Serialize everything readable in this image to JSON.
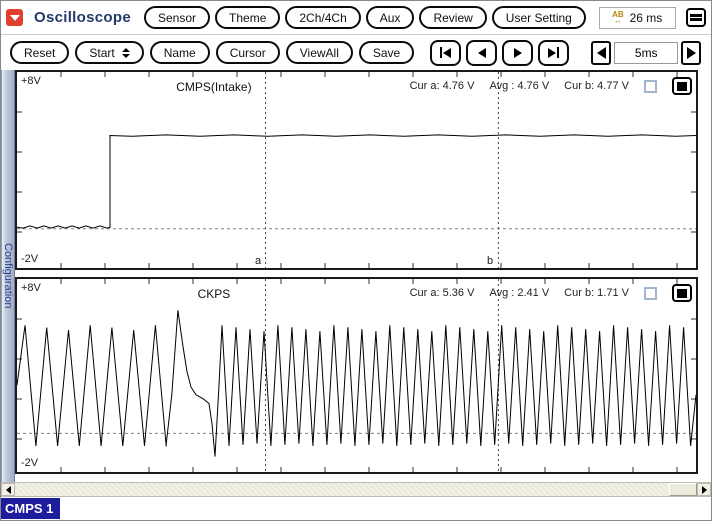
{
  "header": {
    "title": "Oscilloscope",
    "logo_icon": "red-dropdown-arrow",
    "menu_icon": "hamburger-menu",
    "ab_time_icon": "ab-cursor-time",
    "buttons": [
      "Sensor",
      "Theme",
      "2Ch/4Ch",
      "Aux",
      "Review",
      "User Setting"
    ],
    "time_display": "26 ms",
    "ab_icon_text": "AB",
    "ab_icon_arrows": "↔"
  },
  "toolbar": {
    "buttons": [
      "Reset",
      "Start",
      "Name",
      "Cursor",
      "ViewAll",
      "Save"
    ],
    "playback_icons": [
      "skip-to-start",
      "step-back",
      "step-forward",
      "skip-to-end"
    ],
    "timebase_value": "5ms",
    "timebase_icons": [
      "left-arrow",
      "right-arrow"
    ]
  },
  "sidebar": {
    "label": "Configuration"
  },
  "channels": [
    {
      "name": "CMPS(Intake)",
      "v_top": "+8V",
      "v_bottom": "-2V",
      "cur_a": "Cur a: 4.76 V",
      "avg": "Avg : 4.76 V",
      "cur_b": "Cur b: 4.77 V"
    },
    {
      "name": "CKPS",
      "v_top": "+8V",
      "v_bottom": "-2V",
      "cur_a": "Cur a: 5.36 V",
      "avg": "Avg : 2.41 V",
      "cur_b": "Cur b: 1.71 V"
    }
  ],
  "cursors": {
    "a_label": "a",
    "b_label": "b",
    "a_x_frac": 0.366,
    "b_x_frac": 0.709
  },
  "footer": {
    "tab_label": "CMPS 1"
  },
  "colors": {
    "title_navy": "#253a6a",
    "badge_navy": "#1d1d9e",
    "logo_red": "#df4030",
    "ab_gold": "#b8860b",
    "sidebar_text": "#2c3e8f"
  },
  "chart_data": [
    {
      "type": "line",
      "title": "CMPS(Intake)",
      "y_unit": "V",
      "ylim": [
        -2,
        8
      ],
      "grid": "off",
      "zero_reference_line": "dashed",
      "signal": {
        "kind": "step",
        "low_v": 0.08,
        "high_v": 4.76,
        "step_x_frac": 0.137
      },
      "readings": {
        "cursor_a_v": 4.76,
        "avg_v": 4.76,
        "cursor_b_v": 4.77
      }
    },
    {
      "type": "line",
      "title": "CKPS",
      "y_unit": "V",
      "ylim": [
        -2,
        8
      ],
      "grid": "off",
      "zero_reference_line": "dashed",
      "signal": {
        "kind": "tooth-train",
        "peak_v": 5.6,
        "trough_v": -0.65,
        "section1": {
          "first_peak_x_frac": 0.0118,
          "period_frac": 0.032,
          "peak_count": 7
        },
        "gap_points": [
          [
            0.2195,
            -0.65
          ],
          [
            0.228,
            2.0
          ],
          [
            0.237,
            6.38
          ],
          [
            0.2445,
            4.5
          ],
          [
            0.2503,
            3.2
          ],
          [
            0.2562,
            2.4
          ],
          [
            0.2636,
            2.0
          ],
          [
            0.2739,
            1.8
          ],
          [
            0.2828,
            1.55
          ],
          [
            0.2872,
            0.5
          ],
          [
            0.2916,
            -1.2
          ],
          [
            0.2975,
            2.5
          ]
        ],
        "section2": {
          "first_peak_x_frac": 0.3019,
          "period_frac": 0.0206
        }
      },
      "readings": {
        "cursor_a_v": 5.36,
        "avg_v": 2.41,
        "cursor_b_v": 1.71
      }
    }
  ]
}
